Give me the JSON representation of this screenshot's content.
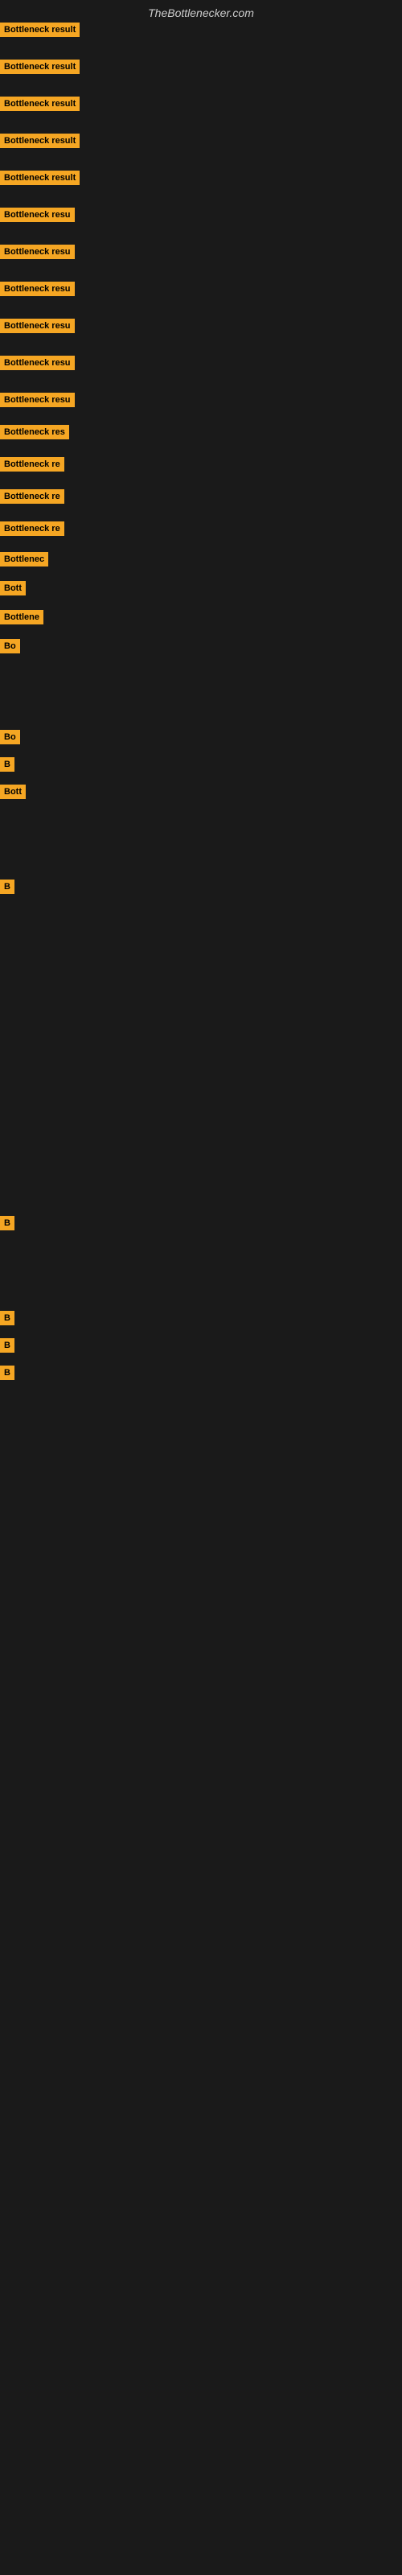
{
  "site": {
    "title": "TheBottlenecker.com"
  },
  "rows": [
    {
      "label": "Bottleneck result",
      "spacer": 25
    },
    {
      "label": "Bottleneck result",
      "spacer": 25
    },
    {
      "label": "Bottleneck result",
      "spacer": 25
    },
    {
      "label": "Bottleneck result",
      "spacer": 25
    },
    {
      "label": "Bottleneck result",
      "spacer": 25
    },
    {
      "label": "Bottleneck resu",
      "spacer": 25
    },
    {
      "label": "Bottleneck resu",
      "spacer": 25
    },
    {
      "label": "Bottleneck resu",
      "spacer": 25
    },
    {
      "label": "Bottleneck resu",
      "spacer": 25
    },
    {
      "label": "Bottleneck resu",
      "spacer": 25
    },
    {
      "label": "Bottleneck resu",
      "spacer": 25
    },
    {
      "label": "Bottleneck res",
      "spacer": 20
    },
    {
      "label": "Bottleneck re",
      "spacer": 20
    },
    {
      "label": "Bottleneck re",
      "spacer": 20
    },
    {
      "label": "Bottleneck re",
      "spacer": 20
    },
    {
      "label": "Bottlenec",
      "spacer": 18
    },
    {
      "label": "Bott",
      "spacer": 15
    },
    {
      "label": "Bottlene",
      "spacer": 15
    },
    {
      "label": "Bo",
      "spacer": 15
    },
    {
      "label": "",
      "spacer": 40
    },
    {
      "label": "",
      "spacer": 40
    },
    {
      "label": "Bo",
      "spacer": 15
    },
    {
      "label": "B",
      "spacer": 15
    },
    {
      "label": "Bott",
      "spacer": 15
    },
    {
      "label": "",
      "spacer": 40
    },
    {
      "label": "",
      "spacer": 40
    },
    {
      "label": "B",
      "spacer": 15
    },
    {
      "label": "",
      "spacer": 100
    },
    {
      "label": "",
      "spacer": 100
    },
    {
      "label": "",
      "spacer": 100
    },
    {
      "label": "",
      "spacer": 100
    },
    {
      "label": "",
      "spacer": 60
    },
    {
      "label": "B",
      "spacer": 20
    },
    {
      "label": "",
      "spacer": 40
    },
    {
      "label": "",
      "spacer": 40
    },
    {
      "label": "B",
      "spacer": 15
    },
    {
      "label": "B",
      "spacer": 15
    },
    {
      "label": "B",
      "spacer": 15
    }
  ]
}
